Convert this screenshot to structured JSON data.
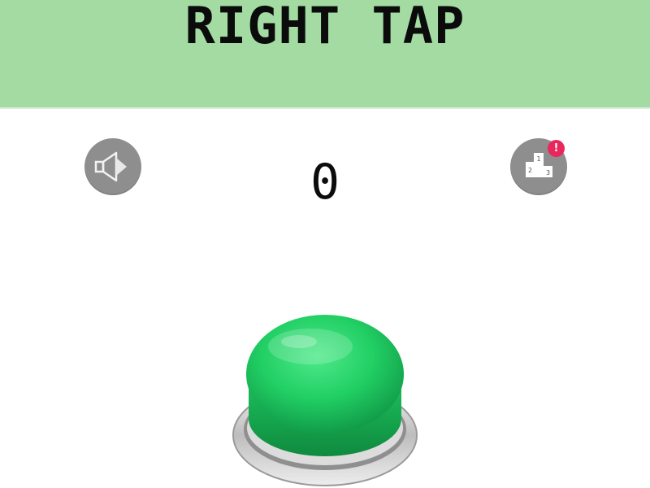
{
  "game": {
    "title": "RIGHT TAP",
    "score": "0",
    "leaderboard_badge": "!"
  },
  "icons": {
    "sound": "speaker-icon",
    "leaderboard": "podium-icon",
    "podium_labels": [
      "1",
      "2",
      "3"
    ]
  },
  "colors": {
    "header_bg": "#a3dba3",
    "icon_button_bg": "#8e8e8e",
    "badge_bg": "#e8285c",
    "tap_button": "#1fcf66",
    "tap_button_rim": "#d7d7d7"
  }
}
